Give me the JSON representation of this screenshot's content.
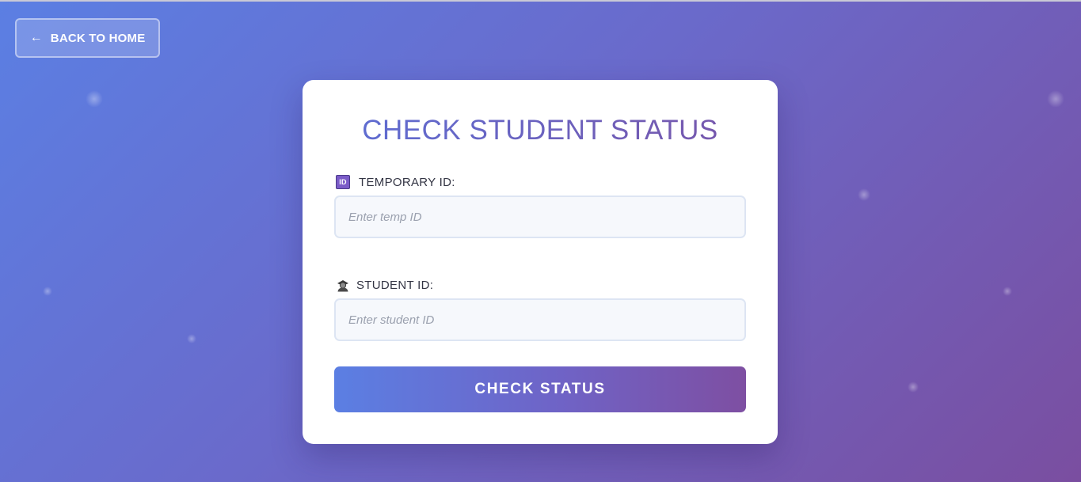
{
  "nav": {
    "back_arrow": "←",
    "back_label": "BACK TO HOME"
  },
  "form": {
    "title": "CHECK STUDENT STATUS",
    "temp_id": {
      "icon": "id-card-icon",
      "icon_text": "ID",
      "label": "TEMPORARY ID:",
      "value": "",
      "placeholder": "Enter temp ID"
    },
    "student_id": {
      "icon": "student-icon",
      "label": "STUDENT ID:",
      "value": "",
      "placeholder": "Enter student ID"
    },
    "submit_label": "CHECK STATUS"
  },
  "colors": {
    "gradient_start": "#5b7fe3",
    "gradient_end": "#7a4ea0",
    "card_background": "#ffffff",
    "input_background": "#f6f8fc"
  }
}
